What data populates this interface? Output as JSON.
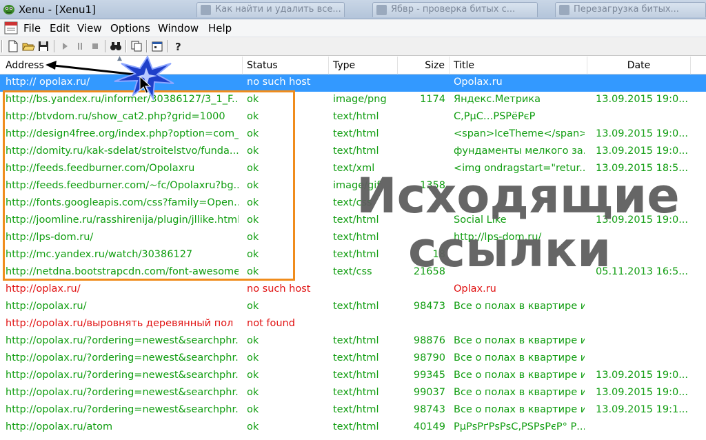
{
  "window": {
    "title": "Xenu - [Xenu1]",
    "background_tabs": [
      "Как найти и удалить все...",
      "Ябвр - проверка битых с...",
      "Перезагрузка битых..."
    ]
  },
  "menu": {
    "items": [
      "File",
      "Edit",
      "View",
      "Options",
      "Window",
      "Help"
    ]
  },
  "toolbar": {
    "buttons": [
      "new-file-icon",
      "open-folder-icon",
      "save-icon",
      "play-icon",
      "pause-icon",
      "stop-icon",
      "binoculars-icon",
      "copy-icon",
      "properties-icon",
      "help-icon"
    ]
  },
  "table": {
    "columns": [
      "Address",
      "Status",
      "Type",
      "Size",
      "Title",
      "Date"
    ],
    "rows": [
      {
        "address": "http:// opolax.ru/",
        "status": "no such host",
        "type": "",
        "size": "",
        "title": "Opolax.ru",
        "date": "",
        "state": "selected"
      },
      {
        "address": "http://bs.yandex.ru/informer/30386127/3_1_F...",
        "status": "ok",
        "type": "image/png",
        "size": "1174",
        "title": "Яндекс.Метрика",
        "date": "13.09.2015  19:0...",
        "state": "ok"
      },
      {
        "address": "http://btvdom.ru/show_cat2.php?grid=1000",
        "status": "ok",
        "type": "text/html",
        "size": "",
        "title": "С,РµС…РЅРёРєР",
        "date": "",
        "state": "ok"
      },
      {
        "address": "http://design4free.org/index.php?option=com_...",
        "status": "ok",
        "type": "text/html",
        "size": "",
        "title": "<span>IceTheme</span>",
        "date": "13.09.2015  19:0...",
        "state": "ok"
      },
      {
        "address": "http://domity.ru/kak-sdelat/stroitelstvo/funda...",
        "status": "ok",
        "type": "text/html",
        "size": "",
        "title": "фундаменты мелкого за...",
        "date": "13.09.2015  19:0...",
        "state": "ok"
      },
      {
        "address": "http://feeds.feedburner.com/Opolaxru",
        "status": "ok",
        "type": "text/xml",
        "size": "",
        "title": "<img ondragstart=\"retur...",
        "date": "13.09.2015  18:5...",
        "state": "ok"
      },
      {
        "address": "http://feeds.feedburner.com/~fc/Opolaxru?bg...",
        "status": "ok",
        "type": "image/gif",
        "size": "1358",
        "title": "",
        "date": "",
        "state": "ok"
      },
      {
        "address": "http://fonts.googleapis.com/css?family=Open...",
        "status": "ok",
        "type": "text/css",
        "size": "",
        "title": "",
        "date": "",
        "state": "ok"
      },
      {
        "address": "http://joomline.ru/rasshirenija/plugin/jllike.html",
        "status": "ok",
        "type": "text/html",
        "size": "",
        "title": "Social Like",
        "date": "13.09.2015  19:0...",
        "state": "ok"
      },
      {
        "address": "http://lps-dom.ru/",
        "status": "ok",
        "type": "text/html",
        "size": "",
        "title": "http://lps-dom.ru/",
        "date": "",
        "state": "ok"
      },
      {
        "address": "http://mc.yandex.ru/watch/30386127",
        "status": "ok",
        "type": "text/html",
        "size": "18",
        "title": "",
        "date": "",
        "state": "ok"
      },
      {
        "address": "http://netdna.bootstrapcdn.com/font-awesome...",
        "status": "ok",
        "type": "text/css",
        "size": "21658",
        "title": "",
        "date": "05.11.2013  16:5...",
        "state": "ok"
      },
      {
        "address": "http://oplax.ru/",
        "status": "no such host",
        "type": "",
        "size": "",
        "title": "Oplax.ru",
        "date": "",
        "state": "err"
      },
      {
        "address": "http://opolax.ru/",
        "status": "ok",
        "type": "text/html",
        "size": "98473",
        "title": "Все о полах в квартире и...",
        "date": "",
        "state": "ok"
      },
      {
        "address": "http://opolax.ru/выровнять деревянный пол",
        "status": "not found",
        "type": "",
        "size": "",
        "title": "",
        "date": "",
        "state": "err"
      },
      {
        "address": "http://opolax.ru/?ordering=newest&searchphr...",
        "status": "ok",
        "type": "text/html",
        "size": "98876",
        "title": "Все о полах в квартире и...",
        "date": "",
        "state": "ok"
      },
      {
        "address": "http://opolax.ru/?ordering=newest&searchphr...",
        "status": "ok",
        "type": "text/html",
        "size": "98790",
        "title": "Все о полах в квартире и...",
        "date": "",
        "state": "ok"
      },
      {
        "address": "http://opolax.ru/?ordering=newest&searchphr...",
        "status": "ok",
        "type": "text/html",
        "size": "99345",
        "title": "Все о полах в квартире и...",
        "date": "13.09.2015  19:0...",
        "state": "ok"
      },
      {
        "address": "http://opolax.ru/?ordering=newest&searchphr...",
        "status": "ok",
        "type": "text/html",
        "size": "99037",
        "title": "Все о полах в квартире и...",
        "date": "13.09.2015  19:0...",
        "state": "ok"
      },
      {
        "address": "http://opolax.ru/?ordering=newest&searchphr...",
        "status": "ok",
        "type": "text/html",
        "size": "98743",
        "title": "Все о полах в квартире и...",
        "date": "13.09.2015  19:1...",
        "state": "ok"
      },
      {
        "address": "http://opolax.ru/atom",
        "status": "ok",
        "type": "text/html",
        "size": "40149",
        "title": "РµРѕРґРѕРѕС‚РЅРѕРєР° Р...",
        "date": "",
        "state": "ok"
      }
    ]
  },
  "overlay": {
    "line1": "Исходящие",
    "line2": "ссылки"
  },
  "colors": {
    "ok": "#109d10",
    "error": "#e01010",
    "selected": "#3399ff",
    "highlight_box": "#f08c1c"
  }
}
